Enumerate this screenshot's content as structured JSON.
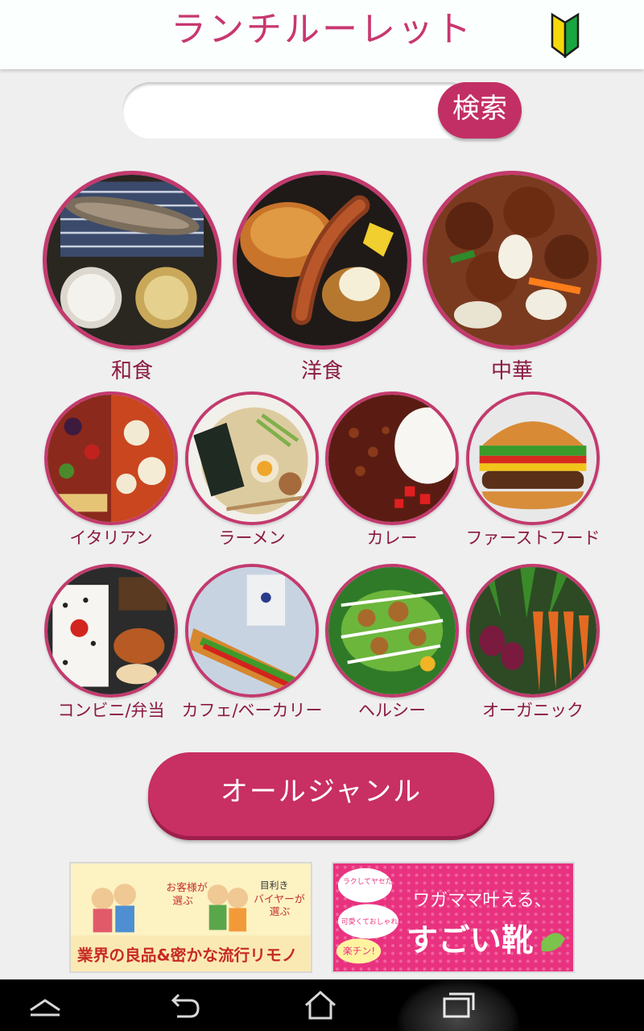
{
  "app": {
    "title": "ランチルーレット",
    "beginner_icon": "wakaba-mark-icon"
  },
  "search": {
    "placeholder": "",
    "value": "",
    "button_label": "検索"
  },
  "genres_top": [
    {
      "label": "和食",
      "icon": "washoku-photo"
    },
    {
      "label": "洋食",
      "icon": "yoshoku-photo"
    },
    {
      "label": "中華",
      "icon": "chuka-photo"
    }
  ],
  "genres_mid": [
    {
      "label": "イタリアン",
      "icon": "italian-photo"
    },
    {
      "label": "ラーメン",
      "icon": "ramen-photo"
    },
    {
      "label": "カレー",
      "icon": "curry-photo"
    },
    {
      "label": "ファーストフード",
      "icon": "fastfood-photo"
    }
  ],
  "genres_bottom": [
    {
      "label": "コンビニ/弁当",
      "icon": "bento-photo"
    },
    {
      "label": "カフェ/ベーカリー",
      "icon": "cafe-photo"
    },
    {
      "label": "ヘルシー",
      "icon": "healthy-photo"
    },
    {
      "label": "オーガニック",
      "icon": "organic-photo"
    }
  ],
  "all_genre_button": "オールジャンル",
  "ads": [
    {
      "line1": "お客様が",
      "line2": "選ぶ",
      "line3": "目利き",
      "line4": "バイヤーが",
      "line5": "選ぶ",
      "bottom": "業界の良品&密かな流行リモノ"
    },
    {
      "badge1a": "ラクしてヤセたい",
      "badge2a": "可愛くておしゃれ♪",
      "badge3": "楽チン!",
      "headline": "ワガママ叶える、",
      "big": "すごい靴"
    }
  ],
  "system_nav": [
    "back-icon",
    "home-icon",
    "recent-apps-icon",
    "menu-up-icon"
  ]
}
